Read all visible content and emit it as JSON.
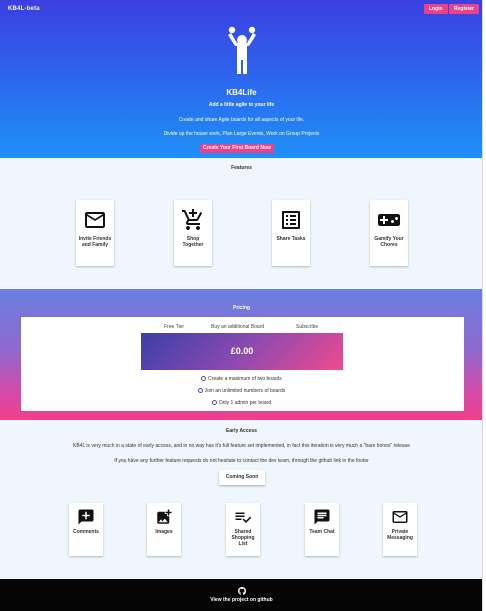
{
  "header": {
    "brand": "KB4L-beta",
    "login_label": "Login",
    "register_label": "Register"
  },
  "hero": {
    "title": "KB4Life",
    "subtitle": "Add a little agile to your life",
    "line1": "Create and share Agile boards for all aspects of your life.",
    "line2": "Divide up the house work, Plan Large Events, Work on Group Projects",
    "cta_label": "Create Your First Board Now"
  },
  "features": {
    "title": "Features",
    "items": [
      {
        "label": "Invite Friends and Family",
        "icon": "mail-icon"
      },
      {
        "label": "Shop Together",
        "icon": "add-shopping-cart-icon"
      },
      {
        "label": "Share Tasks",
        "icon": "list-icon"
      },
      {
        "label": "Gamify Your Chores",
        "icon": "gamepad-icon"
      }
    ]
  },
  "pricing": {
    "title": "Pricing",
    "tabs": [
      "Free Tier",
      "Buy an additional Board",
      "Subscribe"
    ],
    "price": "£0.00",
    "features": [
      "Create a maximum of two boards",
      "Join an unlimited numbers of boards",
      "Only 1 admin per board"
    ]
  },
  "early_access": {
    "title": "Early Access",
    "text1": "KB4L is very much in a state of early access, and in no way has it's full feature set implemented, in fact this iteration is very much a \"bare bones\" release",
    "text2": "If you have any further feature requests do not hesitate to contact the dev team, through the github link in the footer",
    "button_label": "Coming Soon",
    "items": [
      {
        "label": "Comments",
        "icon": "comment-add-icon"
      },
      {
        "label": "Images",
        "icon": "add-photo-icon"
      },
      {
        "label": "Shared Shopping List",
        "icon": "playlist-check-icon"
      },
      {
        "label": "Team Chat",
        "icon": "chat-icon"
      },
      {
        "label": "Private Messaging",
        "icon": "mail-icon"
      }
    ]
  },
  "footer": {
    "link_label": "View the project on github",
    "icon": "github-icon"
  },
  "colors": {
    "accent": "#e9418a",
    "hero_top": "#3b3fe0",
    "hero_bottom": "#1e90f6",
    "footer": "#050505"
  }
}
